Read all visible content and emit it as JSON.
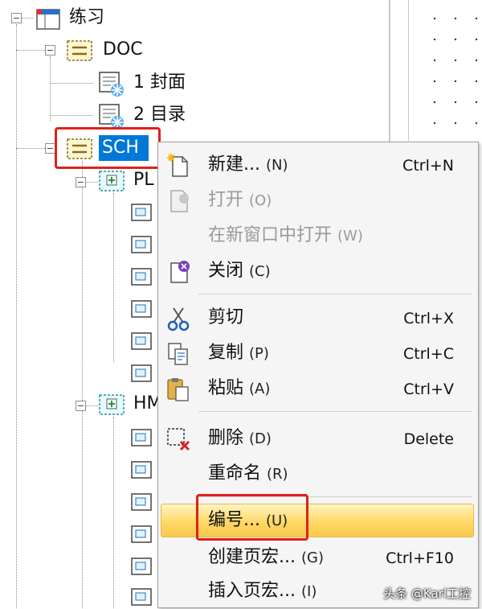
{
  "tree": {
    "root": {
      "label": "练习",
      "expander": "−"
    },
    "doc": {
      "label": "DOC",
      "expander": "−"
    },
    "page1": {
      "label": "1 封面"
    },
    "page2": {
      "label": "2 目录"
    },
    "sch": {
      "label": "SCH",
      "expander": "−"
    },
    "pl": {
      "label": "PL",
      "expander": "−"
    },
    "hm": {
      "label": "HM",
      "expander": "−"
    }
  },
  "context_menu": {
    "items": [
      {
        "label": "新建...",
        "key": "(N)",
        "shortcut": "Ctrl+N",
        "icon": "new-doc-icon"
      },
      {
        "label": "打开",
        "key": "(O)",
        "shortcut": "",
        "icon": "open-icon",
        "disabled": true
      },
      {
        "label": "在新窗口中打开",
        "key": "(W)",
        "shortcut": "",
        "disabled": true
      },
      {
        "label": "关闭",
        "key": "(C)",
        "shortcut": "",
        "icon": "close-doc-icon"
      },
      {
        "label": "剪切",
        "key": "",
        "shortcut": "Ctrl+X",
        "icon": "scissors-icon"
      },
      {
        "label": "复制",
        "key": "(P)",
        "shortcut": "Ctrl+C",
        "icon": "copy-icon"
      },
      {
        "label": "粘贴",
        "key": "(A)",
        "shortcut": "Ctrl+V",
        "icon": "paste-icon"
      },
      {
        "label": "删除",
        "key": "(D)",
        "shortcut": "Delete",
        "icon": "delete-icon"
      },
      {
        "label": "重命名",
        "key": "(R)",
        "shortcut": ""
      },
      {
        "label": "编号...",
        "key": "(U)",
        "shortcut": "",
        "highlighted": true
      },
      {
        "label": "创建页宏...",
        "key": "(G)",
        "shortcut": "Ctrl+F10"
      },
      {
        "label": "插入页宏...",
        "key": "(I)",
        "shortcut": ""
      }
    ]
  },
  "watermark": "头条 @Karl工控",
  "colors": {
    "selection": "#0078d7",
    "highlight_box": "#e0201b",
    "menu_highlight": "#ffd866"
  }
}
